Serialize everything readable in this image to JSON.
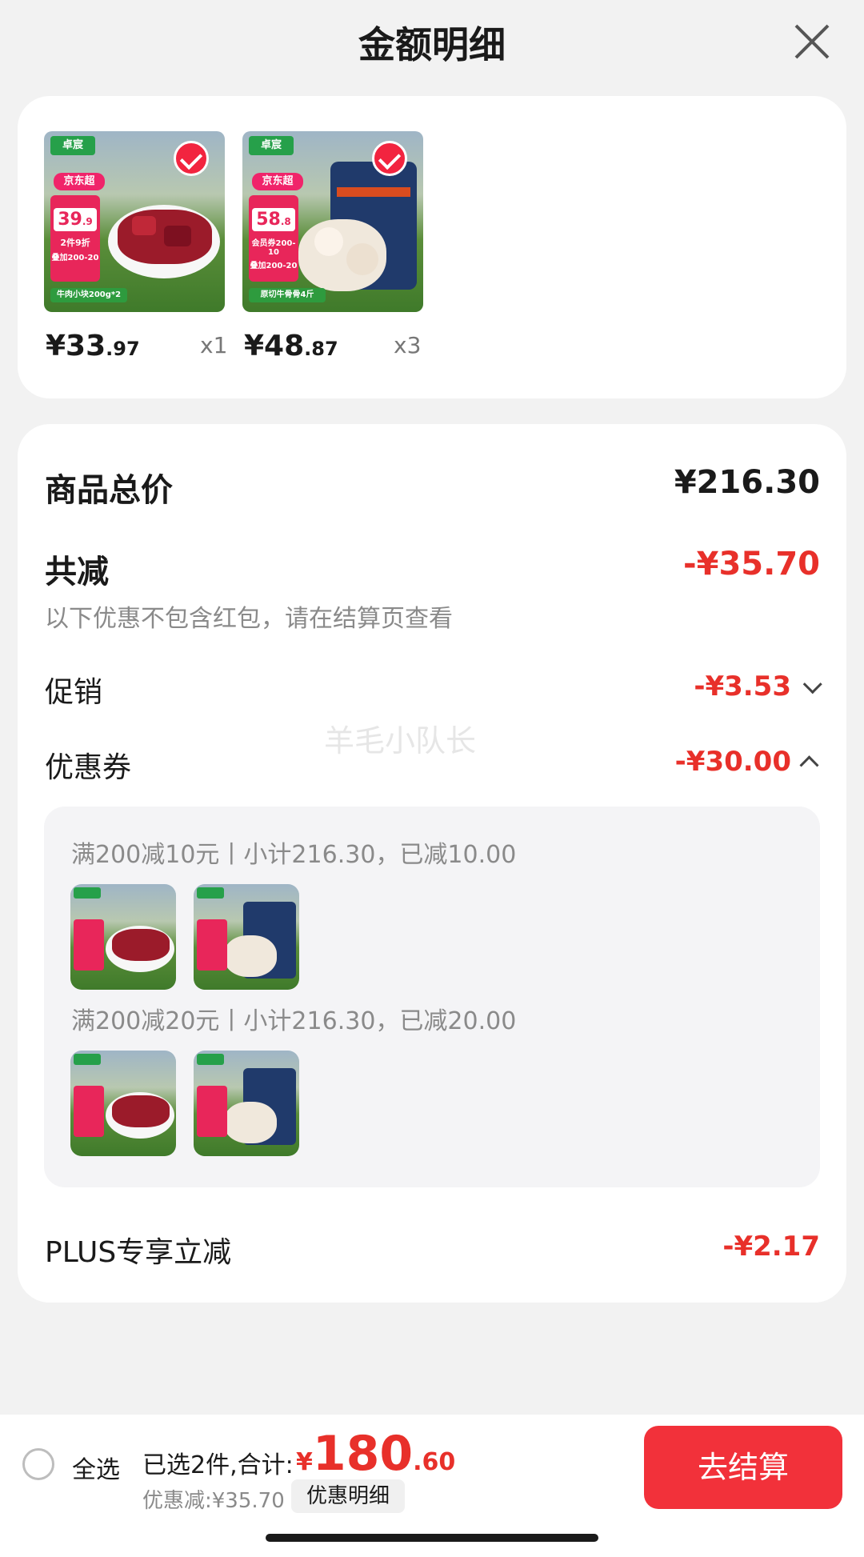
{
  "header": {
    "title": "金额明细"
  },
  "products": [
    {
      "brand": "卓宸",
      "promo_badge": "京东超",
      "tag_price_int": "39",
      "tag_price_dec": ".9",
      "tag_line1": "2件9折",
      "tag_line2": "叠加200-20",
      "strip": "牛肉小块200g*2",
      "price_int": "¥33",
      "price_dec": ".97",
      "qty": "x1",
      "checked": true
    },
    {
      "brand": "卓宸",
      "promo_badge": "京东超",
      "tag_price_int": "58",
      "tag_price_dec": ".8",
      "tag_line1": "会员券200-10",
      "tag_line2": "叠加200-20",
      "strip": "原切牛骨骨4斤",
      "price_int": "¥48",
      "price_dec": ".87",
      "qty": "x3",
      "checked": true
    }
  ],
  "details": {
    "total_label": "商品总价",
    "total_value": "¥216.30",
    "reduce_label": "共减",
    "reduce_value": "-¥35.70",
    "reduce_note": "以下优惠不包含红包，请在结算页查看",
    "promo_label": "促销",
    "promo_value": "-¥3.53",
    "coupon_label": "优惠券",
    "coupon_value": "-¥30.00",
    "coupons": [
      {
        "text": "满200减10元丨小计216.30，已减10.00"
      },
      {
        "text": "满200减20元丨小计216.30，已减20.00"
      }
    ],
    "plus_label": "PLUS专享立减",
    "plus_value": "-¥2.17"
  },
  "watermark": "羊毛小队长",
  "bottom_bar": {
    "select_all": "全选",
    "selected_text": "已选2件,合计:",
    "total_symbol": "¥",
    "total_int": "180",
    "total_dec": ".60",
    "discount_text": "优惠减:¥35.70",
    "discount_button": "优惠明细",
    "checkout_button": "去结算"
  },
  "colors": {
    "accent_red": "#e8302a",
    "checkout_red": "#f2313a",
    "card_bg": "#ffffff",
    "page_bg": "#f2f2f2"
  }
}
